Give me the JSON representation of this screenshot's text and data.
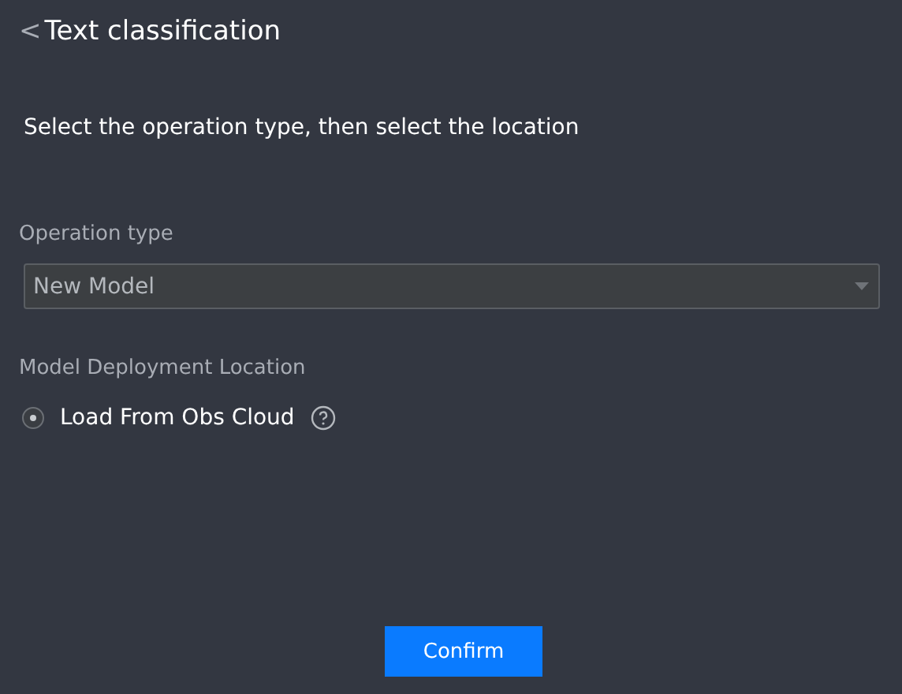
{
  "header": {
    "back": "<",
    "title": "Text classification"
  },
  "instruction": "Select the operation type, then select the location",
  "operation_type": {
    "label": "Operation type",
    "value": "New Model"
  },
  "deployment": {
    "label": "Model Deployment Location",
    "options": [
      {
        "label": "Load From Obs Cloud",
        "selected": true,
        "help": true
      }
    ]
  },
  "confirm": "Confirm"
}
